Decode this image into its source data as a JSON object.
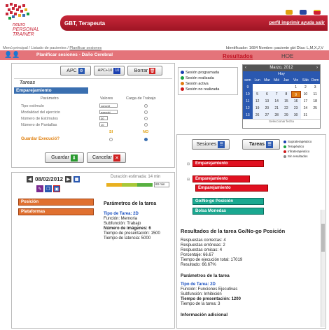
{
  "header": {
    "user": "GBT, Terapeuta",
    "links": "perfil  imprimir  ayuda  salir",
    "logo_text": [
      "neuro",
      "PERSONAL",
      "TRAINER"
    ]
  },
  "breadcrumb": {
    "prefix": "Menú principal / Listado de pacientes / ",
    "current": "Planificar sesiones"
  },
  "patient_info": "Identificador: 1684   Nombre: paciente gbt   Días: L,M,X,J,V",
  "page_bar": {
    "title": "Planificar sesiones - Daño Cerebral",
    "results": "Resultados",
    "hoe": "HOE"
  },
  "left_toolbar": {
    "apc": "APC",
    "apc10": "APC+10",
    "borrar": "Borrar"
  },
  "tareas_panel": {
    "title": "Tareas",
    "subtitle": "Emparejamiento",
    "headers": [
      "Parámetro",
      "Valores",
      "Carga de Trabajo"
    ],
    "rows": [
      {
        "param": "Tipo estímulo",
        "value": "concret"
      },
      {
        "param": "Modalidad del ejercicio",
        "value": "exercici"
      },
      {
        "param": "Número de Estímulos",
        "value": "30"
      },
      {
        "param": "Número de Pantallas",
        "value": "10"
      }
    ],
    "si": "SI",
    "no": "NO",
    "guardar_label": "Guardar Execució?",
    "guardar": "Guardar",
    "cancelar": "Cancelar"
  },
  "legend": [
    {
      "label": "Sesión programada",
      "color": "#1a3fb0"
    },
    {
      "label": "Sesión realizada",
      "color": "#18a040"
    },
    {
      "label": "Sesión activa",
      "color": "#e07a10"
    },
    {
      "label": "Sesión no realizada",
      "color": "#d01818"
    }
  ],
  "calendar": {
    "month": "Marzo, 2012",
    "today": "Hoy",
    "weekdays": [
      "sem",
      "Lun",
      "Mar",
      "Mié",
      "Jue",
      "Vie",
      "Sáb",
      "Dom"
    ],
    "weeks": [
      [
        "9",
        "",
        "",
        "",
        "",
        "1",
        "2",
        "3",
        "4"
      ],
      [
        "10",
        "5",
        "6",
        "7",
        "8",
        "9",
        "10",
        "11"
      ],
      [
        "11",
        "12",
        "13",
        "14",
        "15",
        "16",
        "17",
        "18"
      ],
      [
        "12",
        "19",
        "20",
        "21",
        "22",
        "23",
        "24",
        "25"
      ],
      [
        "13",
        "26",
        "27",
        "28",
        "29",
        "30",
        "31",
        ""
      ]
    ],
    "footer": "Seleccionar fecha"
  },
  "session": {
    "date": "08/02/2012",
    "duration": "Duración estimada: 14 min",
    "duration_select": "60 min",
    "items": [
      "Posición",
      "Plataformas"
    ]
  },
  "params": {
    "title": "Parámetros de la tarea",
    "type": "Tipo de Tarea: 2D",
    "lines": [
      "Función: Memoria",
      "Subfunción: Trabajo"
    ],
    "bold_line": "Número de imágenes: 6",
    "tail": [
      "Tiempo de presentación: 1500",
      "Tiempo de latencia: 5000"
    ]
  },
  "right_toolbar": {
    "sesiones": "Sesiones",
    "tareas": "Tareas"
  },
  "legend2": [
    {
      "label": "Supraterapéutico",
      "color": "#1a3fb0"
    },
    {
      "label": "Terapéutico",
      "color": "#18a040"
    },
    {
      "label": "Infraterapéutico",
      "color": "#d01818"
    },
    {
      "label": "Sin resultados",
      "color": "#888888"
    }
  ],
  "task_bars": {
    "b1": "Emparejamiento",
    "b2": "Emparejamiento",
    "b3": "Emparejamiento",
    "b4": "Go/No-go Posición",
    "b5": "Bolsa Monedas"
  },
  "results": {
    "title": "Resultados de la tarea Go/No-go Posición",
    "lines": [
      "Respuestas correctas: 4",
      "Respuestas erróneas: 2",
      "Respuestas omisas: 4",
      "Porcentaje: 66.67",
      "Tiempo de ejecución total: 17019",
      "Resultado: 66.67%"
    ],
    "params_title": "Parámetros de la tarea",
    "type": "Tipo de Tarea: 2D",
    "p_lines": [
      "Función: Funciones Ejecutivas",
      "Subfunción: Inhibición"
    ],
    "bold_line": "Tiempo de presentación: 1200",
    "tail": "Tiempo de la tarea: 3",
    "info": "Información adicional"
  }
}
